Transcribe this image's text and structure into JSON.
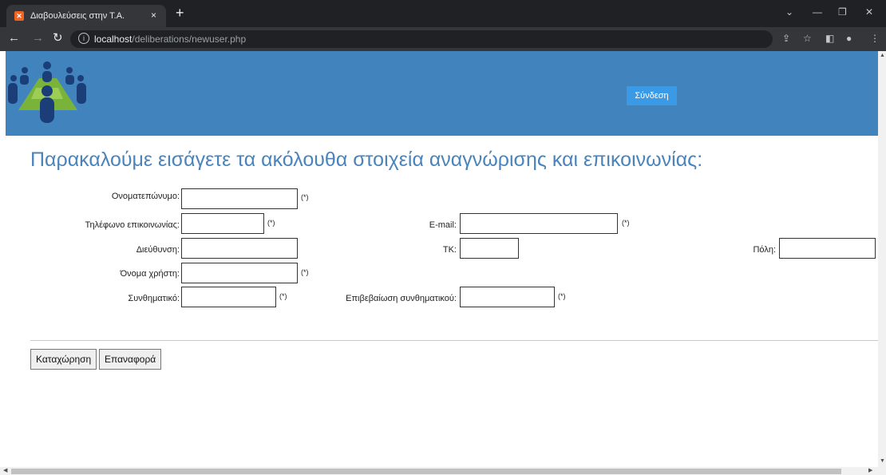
{
  "browser": {
    "tab_title": "Διαβουλεύσεις στην Τ.Α.",
    "tab_favicon": "xampp-icon",
    "tab_close": "×",
    "new_tab": "+",
    "url_host": "localhost",
    "url_path": "/deliberations/newuser.php",
    "icons": [
      "back-icon",
      "forward-icon",
      "reload-icon",
      "info-icon",
      "share-icon",
      "star-icon",
      "sidepanel-icon",
      "profile-icon",
      "menu-icon"
    ]
  },
  "header": {
    "login_label": "Σύνδεση",
    "bg_color": "#4183bd",
    "logo": "people-group-logo"
  },
  "form": {
    "heading": "Παρακαλούμε εισάγετε τα ακόλουθα στοιχεία αναγνώρισης και επικοινωνίας:",
    "fullname_label": "Ονοματεπώνυμο:",
    "phone_label": "Τηλέφωνο επικοινωνίας:",
    "email_label": "E-mail:",
    "address_label": "Διεύθυνση:",
    "postcode_label": "ΤΚ:",
    "city_label": "Πόλη:",
    "username_label": "Όνομα χρήστη:",
    "password_label": "Συνθηματικό:",
    "confirm_label": "Επιβεβαίωση συνθηματικού:",
    "required_mark": "(*)",
    "submit_label": "Καταχώρηση",
    "reset_label": "Επαναφορά"
  }
}
